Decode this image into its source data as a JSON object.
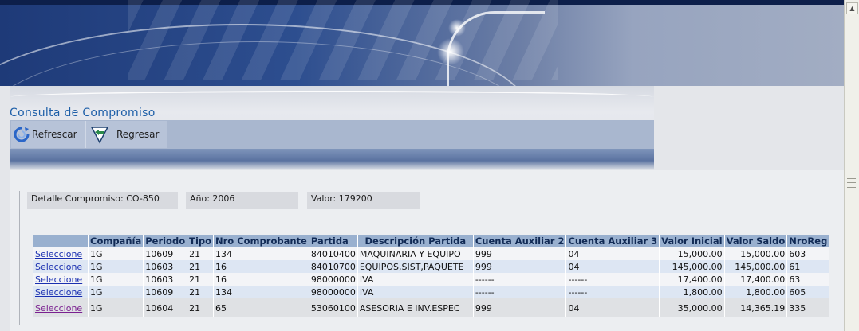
{
  "page": {
    "title": "Consulta de Compromiso"
  },
  "toolbar": {
    "refresh_label": "Refrescar",
    "back_label": "Regresar"
  },
  "detail": {
    "compromiso": "Detalle Compromiso: CO-850",
    "anio": "Año: 2006",
    "valor": "Valor: 179200"
  },
  "table": {
    "headers": [
      "",
      "Compañía",
      "Periodo",
      "Tipo",
      "Nro Comprobante",
      "Partida",
      "Descripción Partida",
      "Cuenta Auxiliar 2",
      "Cuenta Auxiliar 3",
      "Valor Inicial",
      "Valor Saldo",
      "NroReg"
    ],
    "rows": [
      {
        "link": "Seleccione",
        "compania": "1G",
        "periodo": "10609",
        "tipo": "21",
        "nro_comprobante": "134",
        "partida": "84010400",
        "descripcion": "MAQUINARIA Y EQUIPO",
        "cuenta_aux2": "999",
        "cuenta_aux3": "04",
        "valor_inicial": "15,000.00",
        "valor_saldo": "15,000.00",
        "nroreg": "603"
      },
      {
        "link": "Seleccione",
        "compania": "1G",
        "periodo": "10603",
        "tipo": "21",
        "nro_comprobante": "16",
        "partida": "84010700",
        "descripcion": "EQUIPOS,SIST,PAQUETE",
        "cuenta_aux2": "999",
        "cuenta_aux3": "04",
        "valor_inicial": "145,000.00",
        "valor_saldo": "145,000.00",
        "nroreg": "61"
      },
      {
        "link": "Seleccione",
        "compania": "1G",
        "periodo": "10603",
        "tipo": "21",
        "nro_comprobante": "16",
        "partida": "98000000",
        "descripcion": "IVA",
        "cuenta_aux2": "------",
        "cuenta_aux3": "------",
        "valor_inicial": "17,400.00",
        "valor_saldo": "17,400.00",
        "nroreg": "63"
      },
      {
        "link": "Seleccione",
        "compania": "1G",
        "periodo": "10609",
        "tipo": "21",
        "nro_comprobante": "134",
        "partida": "98000000",
        "descripcion": "IVA",
        "cuenta_aux2": "------",
        "cuenta_aux3": "------",
        "valor_inicial": "1,800.00",
        "valor_saldo": "1,800.00",
        "nroreg": "605"
      },
      {
        "link": "Seleccione",
        "compania": "1G",
        "periodo": "10604",
        "tipo": "21",
        "nro_comprobante": "65",
        "partida": "53060100",
        "descripcion": "ASESORIA E INV.ESPEC",
        "cuenta_aux2": "999",
        "cuenta_aux3": "04",
        "valor_inicial": "35,000.00",
        "valor_saldo": "14,365.19",
        "nroreg": "335"
      }
    ]
  },
  "icons": {
    "refresh": "refresh-icon",
    "back": "back-arrow-icon",
    "scroll_up": "scroll-up-arrow-icon"
  },
  "colors": {
    "title": "#1e5fa8",
    "header_bg": "#99b0cf",
    "link": "#1a2fb0",
    "visited_link": "#7a2090"
  }
}
